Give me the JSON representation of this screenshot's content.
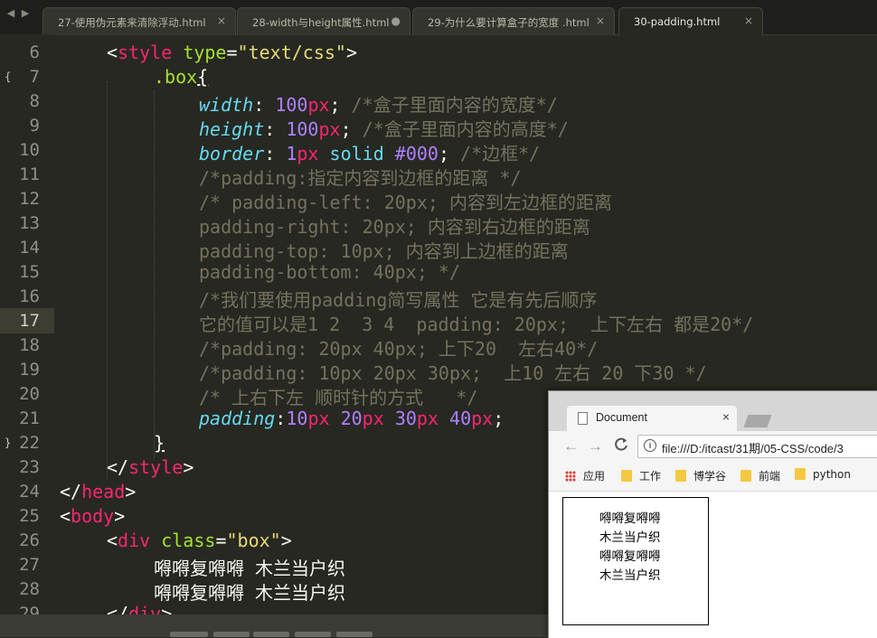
{
  "tabs": [
    {
      "label": "27-使用伪元素来清除浮动.html",
      "close": "×"
    },
    {
      "label": "28-width与height属性.html",
      "close": "●"
    },
    {
      "label": "29-为什么要计算盒子的宽度 .html",
      "close": "×"
    },
    {
      "label": "30-padding.html",
      "close": "×"
    }
  ],
  "nav": {
    "back": "◀",
    "forward": "▶"
  },
  "line_numbers": [
    "6",
    "7",
    "8",
    "9",
    "10",
    "11",
    "12",
    "13",
    "14",
    "15",
    "16",
    "17",
    "18",
    "19",
    "20",
    "21",
    "22",
    "23",
    "24",
    "25",
    "26",
    "27",
    "28",
    "29"
  ],
  "fold_markers": {
    "open": "{",
    "close": "}"
  },
  "code": {
    "l6": {
      "lt": "<",
      "tag": "style",
      "attr": "type",
      "eq": "=",
      "val": "\"text/css\"",
      "gt": ">"
    },
    "l7": {
      "sel": ".box",
      "brace": "{"
    },
    "l8": {
      "prop": "width",
      "colon": ": ",
      "num": "100",
      "unit": "px",
      "semi": ";",
      "cmt": " /*盒子里面内容的宽度*/"
    },
    "l9": {
      "prop": "height",
      "colon": ": ",
      "num": "100",
      "unit": "px",
      "semi": ";",
      "cmt": " /*盒子里面内容的高度*/"
    },
    "l10": {
      "prop": "border",
      "colon": ": ",
      "num": "1",
      "unit": "px",
      "kw": " solid ",
      "hex": "#000",
      "semi": ";",
      "cmt": " /*边框*/"
    },
    "l11": "/*padding:指定内容到边框的距离 */",
    "l12": "/* padding-left: 20px; 内容到左边框的距离",
    "l13": "padding-right: 20px; 内容到右边框的距离",
    "l14": "padding-top: 10px; 内容到上边框的距离",
    "l15": "padding-bottom: 40px; */",
    "l16": "/*我们要使用padding简写属性 它是有先后顺序",
    "l17": "它的值可以是1 2  3 4  padding: 20px;  上下左右 都是20*/",
    "l18": "/*padding: 20px 40px; 上下20  左右40*/",
    "l19": "/*padding: 10px 20px 30px;  上10 左右 20 下30 */",
    "l20": "/* 上右下左 顺时针的方式   */",
    "l21": {
      "prop": "padding",
      "colon": ":",
      "n1": "10",
      "n2": "20",
      "n3": "30",
      "n4": "40",
      "unit": "px",
      "sp": " ",
      "semi": ";"
    },
    "l22": "}",
    "l23": {
      "lt": "</",
      "tag": "style",
      "gt": ">"
    },
    "l24": {
      "lt": "</",
      "tag": "head",
      "gt": ">"
    },
    "l25": {
      "lt": "<",
      "tag": "body",
      "gt": ">"
    },
    "l26": {
      "lt": "<",
      "tag": "div",
      "attr": "class",
      "eq": "=",
      "val": "\"box\"",
      "gt": ">"
    },
    "l27": "嘚嘚复嘚嘚 木兰当户织",
    "l28": "嘚嘚复嘚嘚 木兰当户织",
    "l29": {
      "lt": "</",
      "tag": "div",
      "gt": ">"
    }
  },
  "browser": {
    "tab_title": "Document",
    "tab_close": "×",
    "nav": {
      "back": "←",
      "forward": "→",
      "reload": "C"
    },
    "info_icon": "i",
    "url": "file:///D:/itcast/31期/05-CSS/code/3",
    "bookmarks": [
      "应用",
      "工作",
      "博学谷",
      "前端",
      "python"
    ],
    "page_text": "嘚嘚复嘚嘚\n木兰当户织\n嘚嘚复嘚嘚\n木兰当户织"
  }
}
